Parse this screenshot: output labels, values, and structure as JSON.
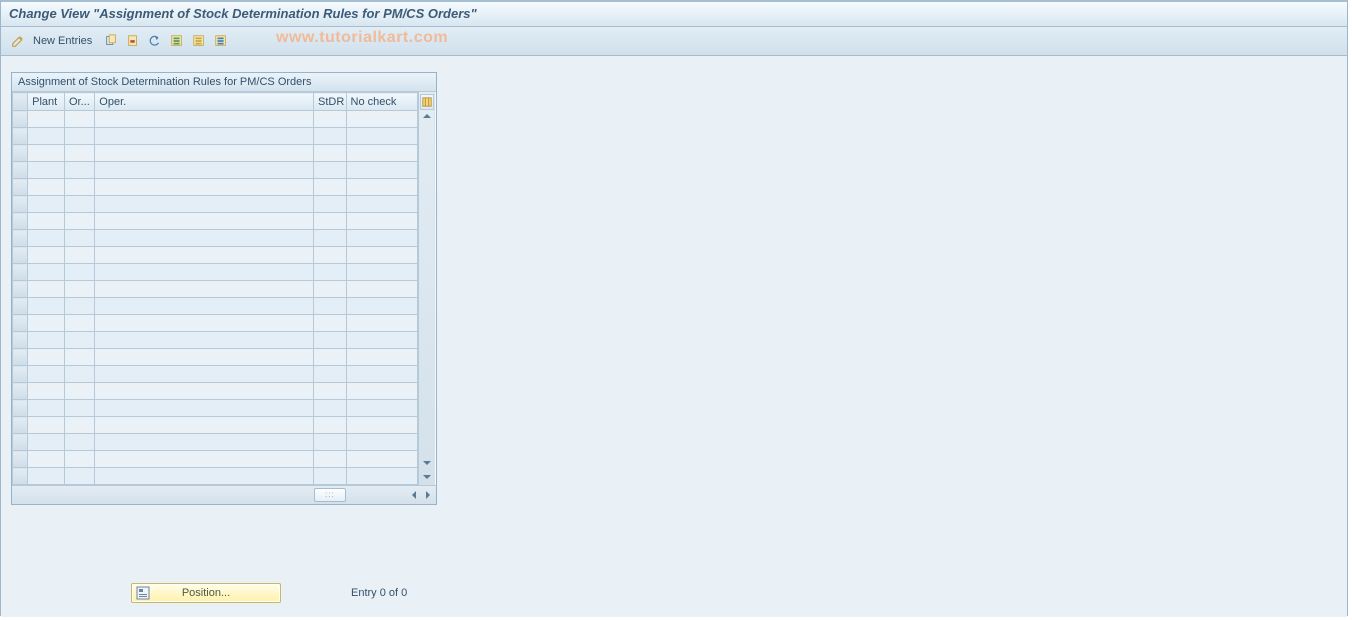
{
  "header": {
    "title": "Change View \"Assignment of Stock Determination Rules for PM/CS Orders\""
  },
  "toolbar": {
    "new_entries_label": "New Entries"
  },
  "watermark": "www.tutorialkart.com",
  "panel": {
    "title": "Assignment of Stock Determination Rules for PM/CS Orders",
    "columns": {
      "plant": "Plant",
      "or": "Or...",
      "oper": "Oper.",
      "stdr": "StDR",
      "nocheck": "No check"
    },
    "row_count": 22
  },
  "footer": {
    "position_label": "Position...",
    "entry_text": "Entry 0 of 0"
  }
}
